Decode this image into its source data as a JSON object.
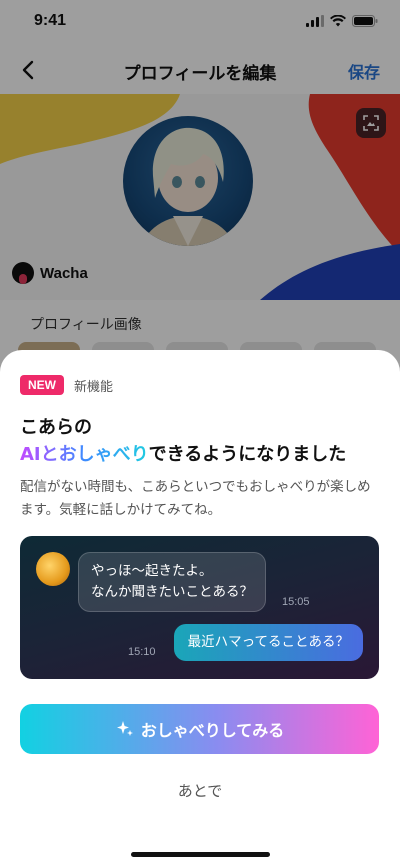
{
  "status": {
    "time": "9:41"
  },
  "nav": {
    "title": "プロフィールを編集",
    "save": "保存"
  },
  "profile": {
    "username": "Wacha",
    "section_label": "プロフィール画像"
  },
  "sheet": {
    "badge": "NEW",
    "badge_label": "新機能",
    "headline_line1": "こあらの",
    "headline_highlight": "AIとおしゃべり",
    "headline_rest": "できるようになりました",
    "description": "配信がない時間も、こあらといつでもおしゃべりが楽しめます。気軽に話しかけてみてね。",
    "chat": {
      "incoming_line1": "やっほ〜起きたよ。",
      "incoming_line2": "なんか聞きたいことある？",
      "incoming_time": "15:05",
      "outgoing": "最近ハマってることある？",
      "outgoing_time": "15:10"
    },
    "cta": "おしゃべりしてみる",
    "later": "あとで"
  },
  "colors": {
    "badge": "#ee2a69",
    "link": "#2a73d6",
    "cta_gradient": [
      "#12d1e2",
      "#ff63d6"
    ]
  }
}
